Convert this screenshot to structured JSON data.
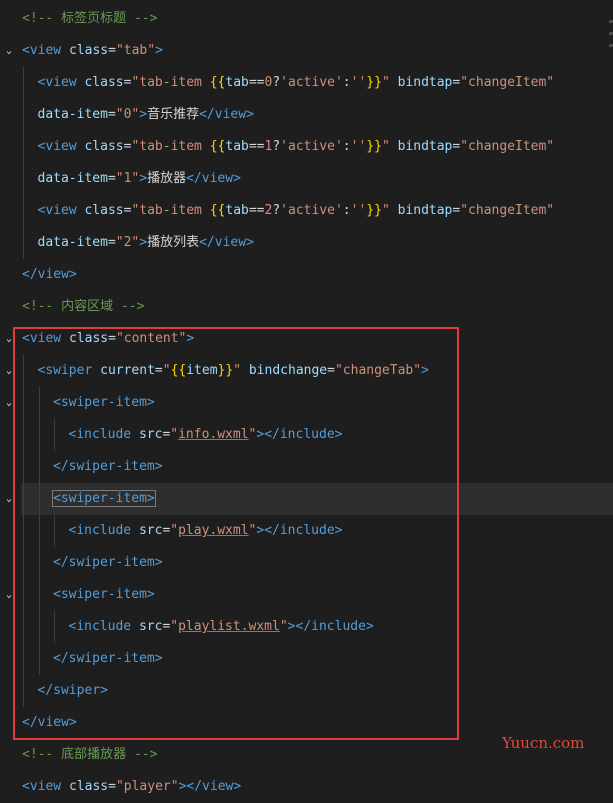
{
  "lines": [
    {
      "indent": 0,
      "tokens": [
        [
          "t-comment",
          "<!-- 标签页标题 -->"
        ]
      ]
    },
    {
      "indent": 0,
      "fold": true,
      "tokens": [
        [
          "t-tag",
          "<view "
        ],
        [
          "t-attr",
          "class"
        ],
        [
          "t-text",
          "="
        ],
        [
          "t-str",
          "\"tab\""
        ],
        [
          "t-tag",
          ">"
        ]
      ]
    },
    {
      "indent": 1,
      "tokens": [
        [
          "t-tag",
          "<view "
        ],
        [
          "t-attr",
          "class"
        ],
        [
          "t-text",
          "="
        ],
        [
          "t-str",
          "\"tab-item "
        ],
        [
          "t-brace",
          "{{"
        ],
        [
          "t-attr",
          "tab"
        ],
        [
          "t-text",
          "=="
        ],
        [
          "t-str",
          "0"
        ],
        [
          "t-text",
          "?"
        ],
        [
          "t-str",
          "'active'"
        ],
        [
          "t-text",
          ":"
        ],
        [
          "t-str",
          "''"
        ],
        [
          "t-brace",
          "}}"
        ],
        [
          "t-str",
          "\""
        ],
        [
          "t-text",
          " "
        ],
        [
          "t-attr",
          "bindtap"
        ],
        [
          "t-text",
          "="
        ],
        [
          "t-str",
          "\"changeItem\""
        ]
      ]
    },
    {
      "indent": 1,
      "tokens": [
        [
          "t-attr",
          "data-item"
        ],
        [
          "t-text",
          "="
        ],
        [
          "t-str",
          "\"0\""
        ],
        [
          "t-tag",
          ">"
        ],
        [
          "t-text",
          "音乐推荐"
        ],
        [
          "t-tag",
          "</view>"
        ]
      ]
    },
    {
      "indent": 1,
      "tokens": [
        [
          "t-tag",
          "<view "
        ],
        [
          "t-attr",
          "class"
        ],
        [
          "t-text",
          "="
        ],
        [
          "t-str",
          "\"tab-item "
        ],
        [
          "t-brace",
          "{{"
        ],
        [
          "t-attr",
          "tab"
        ],
        [
          "t-text",
          "=="
        ],
        [
          "t-str",
          "1"
        ],
        [
          "t-text",
          "?"
        ],
        [
          "t-str",
          "'active'"
        ],
        [
          "t-text",
          ":"
        ],
        [
          "t-str",
          "''"
        ],
        [
          "t-brace",
          "}}"
        ],
        [
          "t-str",
          "\""
        ],
        [
          "t-text",
          " "
        ],
        [
          "t-attr",
          "bindtap"
        ],
        [
          "t-text",
          "="
        ],
        [
          "t-str",
          "\"changeItem\""
        ]
      ]
    },
    {
      "indent": 1,
      "tokens": [
        [
          "t-attr",
          "data-item"
        ],
        [
          "t-text",
          "="
        ],
        [
          "t-str",
          "\"1\""
        ],
        [
          "t-tag",
          ">"
        ],
        [
          "t-text",
          "播放器"
        ],
        [
          "t-tag",
          "</view>"
        ]
      ]
    },
    {
      "indent": 1,
      "tokens": [
        [
          "t-tag",
          "<view "
        ],
        [
          "t-attr",
          "class"
        ],
        [
          "t-text",
          "="
        ],
        [
          "t-str",
          "\"tab-item "
        ],
        [
          "t-brace",
          "{{"
        ],
        [
          "t-attr",
          "tab"
        ],
        [
          "t-text",
          "=="
        ],
        [
          "t-str",
          "2"
        ],
        [
          "t-text",
          "?"
        ],
        [
          "t-str",
          "'active'"
        ],
        [
          "t-text",
          ":"
        ],
        [
          "t-str",
          "''"
        ],
        [
          "t-brace",
          "}}"
        ],
        [
          "t-str",
          "\""
        ],
        [
          "t-text",
          " "
        ],
        [
          "t-attr",
          "bindtap"
        ],
        [
          "t-text",
          "="
        ],
        [
          "t-str",
          "\"changeItem\""
        ]
      ]
    },
    {
      "indent": 1,
      "tokens": [
        [
          "t-attr",
          "data-item"
        ],
        [
          "t-text",
          "="
        ],
        [
          "t-str",
          "\"2\""
        ],
        [
          "t-tag",
          ">"
        ],
        [
          "t-text",
          "播放列表"
        ],
        [
          "t-tag",
          "</view>"
        ]
      ]
    },
    {
      "indent": 0,
      "tokens": [
        [
          "t-tag",
          "</view>"
        ]
      ]
    },
    {
      "indent": 0,
      "tokens": [
        [
          "t-comment",
          "<!-- 内容区域 -->"
        ]
      ]
    },
    {
      "indent": 0,
      "fold": true,
      "tokens": [
        [
          "t-tag",
          "<view "
        ],
        [
          "t-attr",
          "class"
        ],
        [
          "t-text",
          "="
        ],
        [
          "t-str",
          "\"content\""
        ],
        [
          "t-tag",
          ">"
        ]
      ]
    },
    {
      "indent": 1,
      "fold": true,
      "tokens": [
        [
          "t-tag",
          "<swiper "
        ],
        [
          "t-attr",
          "current"
        ],
        [
          "t-text",
          "="
        ],
        [
          "t-str",
          "\""
        ],
        [
          "t-brace",
          "{{"
        ],
        [
          "t-attr",
          "item"
        ],
        [
          "t-brace",
          "}}"
        ],
        [
          "t-str",
          "\""
        ],
        [
          "t-text",
          " "
        ],
        [
          "t-attr",
          "bindchange"
        ],
        [
          "t-text",
          "="
        ],
        [
          "t-str",
          "\"changeTab\""
        ],
        [
          "t-tag",
          ">"
        ]
      ]
    },
    {
      "indent": 2,
      "fold": true,
      "tokens": [
        [
          "t-tag",
          "<swiper-item>"
        ]
      ]
    },
    {
      "indent": 3,
      "tokens": [
        [
          "t-tag",
          "<include "
        ],
        [
          "t-attr",
          "src"
        ],
        [
          "t-text",
          "="
        ],
        [
          "t-str",
          "\""
        ],
        [
          "t-link",
          "info.wxml"
        ],
        [
          "t-str",
          "\""
        ],
        [
          "t-tag",
          "></include>"
        ]
      ]
    },
    {
      "indent": 2,
      "tokens": [
        [
          "t-tag",
          "</swiper-item>"
        ]
      ]
    },
    {
      "indent": 2,
      "fold": true,
      "highlight": true,
      "tokens": [
        [
          "t-cursor",
          "<swiper-item>"
        ]
      ]
    },
    {
      "indent": 3,
      "tokens": [
        [
          "t-tag",
          "<include "
        ],
        [
          "t-attr",
          "src"
        ],
        [
          "t-text",
          "="
        ],
        [
          "t-str",
          "\""
        ],
        [
          "t-link",
          "play.wxml"
        ],
        [
          "t-str",
          "\""
        ],
        [
          "t-tag",
          "></include>"
        ]
      ]
    },
    {
      "indent": 2,
      "tokens": [
        [
          "t-tag",
          "</swiper-item>"
        ]
      ]
    },
    {
      "indent": 2,
      "fold": true,
      "tokens": [
        [
          "t-tag",
          "<swiper-item>"
        ]
      ]
    },
    {
      "indent": 3,
      "tokens": [
        [
          "t-tag",
          "<include "
        ],
        [
          "t-attr",
          "src"
        ],
        [
          "t-text",
          "="
        ],
        [
          "t-str",
          "\""
        ],
        [
          "t-link",
          "playlist.wxml"
        ],
        [
          "t-str",
          "\""
        ],
        [
          "t-tag",
          "></include>"
        ]
      ]
    },
    {
      "indent": 2,
      "tokens": [
        [
          "t-tag",
          "</swiper-item>"
        ]
      ]
    },
    {
      "indent": 1,
      "tokens": [
        [
          "t-tag",
          "</swiper>"
        ]
      ]
    },
    {
      "indent": 0,
      "tokens": [
        [
          "t-tag",
          "</view>"
        ]
      ]
    },
    {
      "indent": 0,
      "tokens": [
        [
          "t-comment",
          "<!-- 底部播放器 -->"
        ]
      ]
    },
    {
      "indent": 0,
      "tokens": [
        [
          "t-tag",
          "<view "
        ],
        [
          "t-attr",
          "class"
        ],
        [
          "t-text",
          "="
        ],
        [
          "t-str",
          "\"player\""
        ],
        [
          "t-tag",
          "></view>"
        ]
      ]
    }
  ],
  "watermark": "Yuucn.com",
  "colors": {
    "background": "#1e1e1e",
    "highlight_box": "#e23b3b",
    "watermark": "#e8453c"
  }
}
